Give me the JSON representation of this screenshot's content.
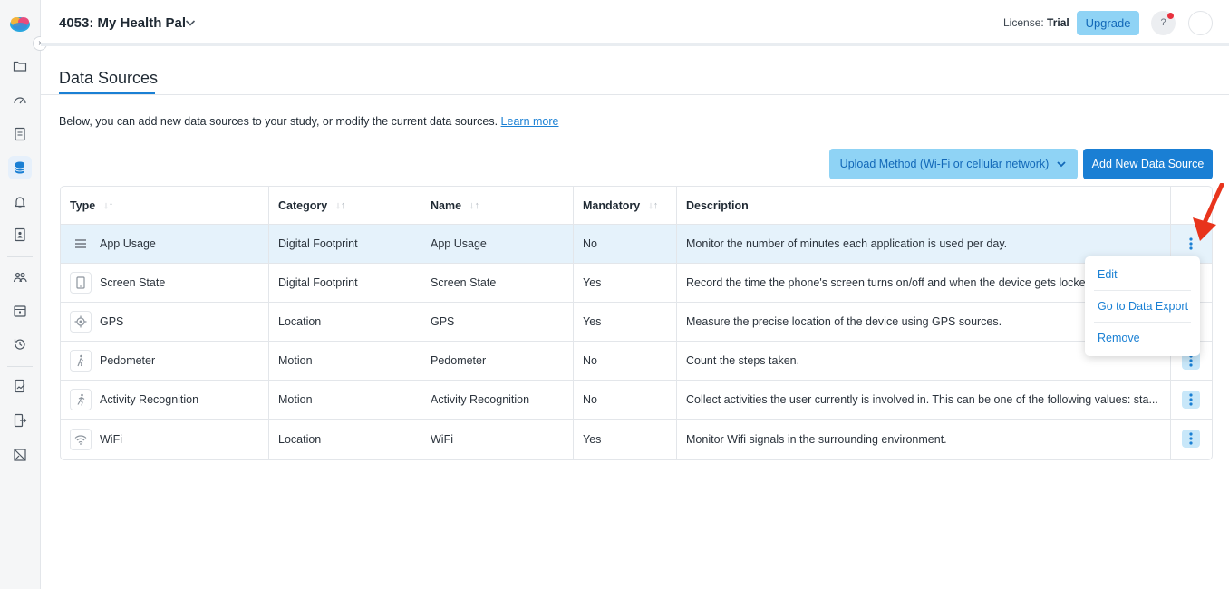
{
  "header": {
    "study_title": "4053: My Health Pal",
    "license_label": "License:",
    "license_value": "Trial",
    "upgrade_label": "Upgrade",
    "help_label": "?"
  },
  "page": {
    "title": "Data Sources",
    "intro": "Below, you can add new data sources to your study, or modify the current data sources.",
    "learn_more": "Learn more",
    "upload_method_label": "Upload Method (Wi-Fi or cellular network)",
    "add_source_label": "Add New Data Source"
  },
  "table": {
    "columns": [
      "Type",
      "Category",
      "Name",
      "Mandatory",
      "Description"
    ],
    "rows": [
      {
        "type": "App Usage",
        "icon": "app-usage-icon",
        "category": "Digital Footprint",
        "name": "App Usage",
        "mandatory": "No",
        "description": "Monitor the number of minutes each application is used per day."
      },
      {
        "type": "Screen State",
        "icon": "screen-state-icon",
        "category": "Digital Footprint",
        "name": "Screen State",
        "mandatory": "Yes",
        "description": "Record the time the phone's screen turns on/off and when the device gets locke"
      },
      {
        "type": "GPS",
        "icon": "gps-icon",
        "category": "Location",
        "name": "GPS",
        "mandatory": "Yes",
        "description": "Measure the precise location of the device using GPS sources."
      },
      {
        "type": "Pedometer",
        "icon": "walking-icon",
        "category": "Motion",
        "name": "Pedometer",
        "mandatory": "No",
        "description": "Count the steps taken."
      },
      {
        "type": "Activity Recognition",
        "icon": "running-icon",
        "category": "Motion",
        "name": "Activity Recognition",
        "mandatory": "No",
        "description": "Collect activities the user currently is involved in. This can be one of the following values: sta..."
      },
      {
        "type": "WiFi",
        "icon": "wifi-icon",
        "category": "Location",
        "name": "WiFi",
        "mandatory": "Yes",
        "description": "Monitor Wifi signals in the surrounding environment."
      }
    ]
  },
  "menu": {
    "items": [
      "Edit",
      "Go to Data Export",
      "Remove"
    ]
  },
  "colors": {
    "accent": "#1a7fd4",
    "light_accent": "#8fd3f5",
    "selected_row": "#e5f2fb",
    "annotation_arrow": "#e8341c"
  }
}
